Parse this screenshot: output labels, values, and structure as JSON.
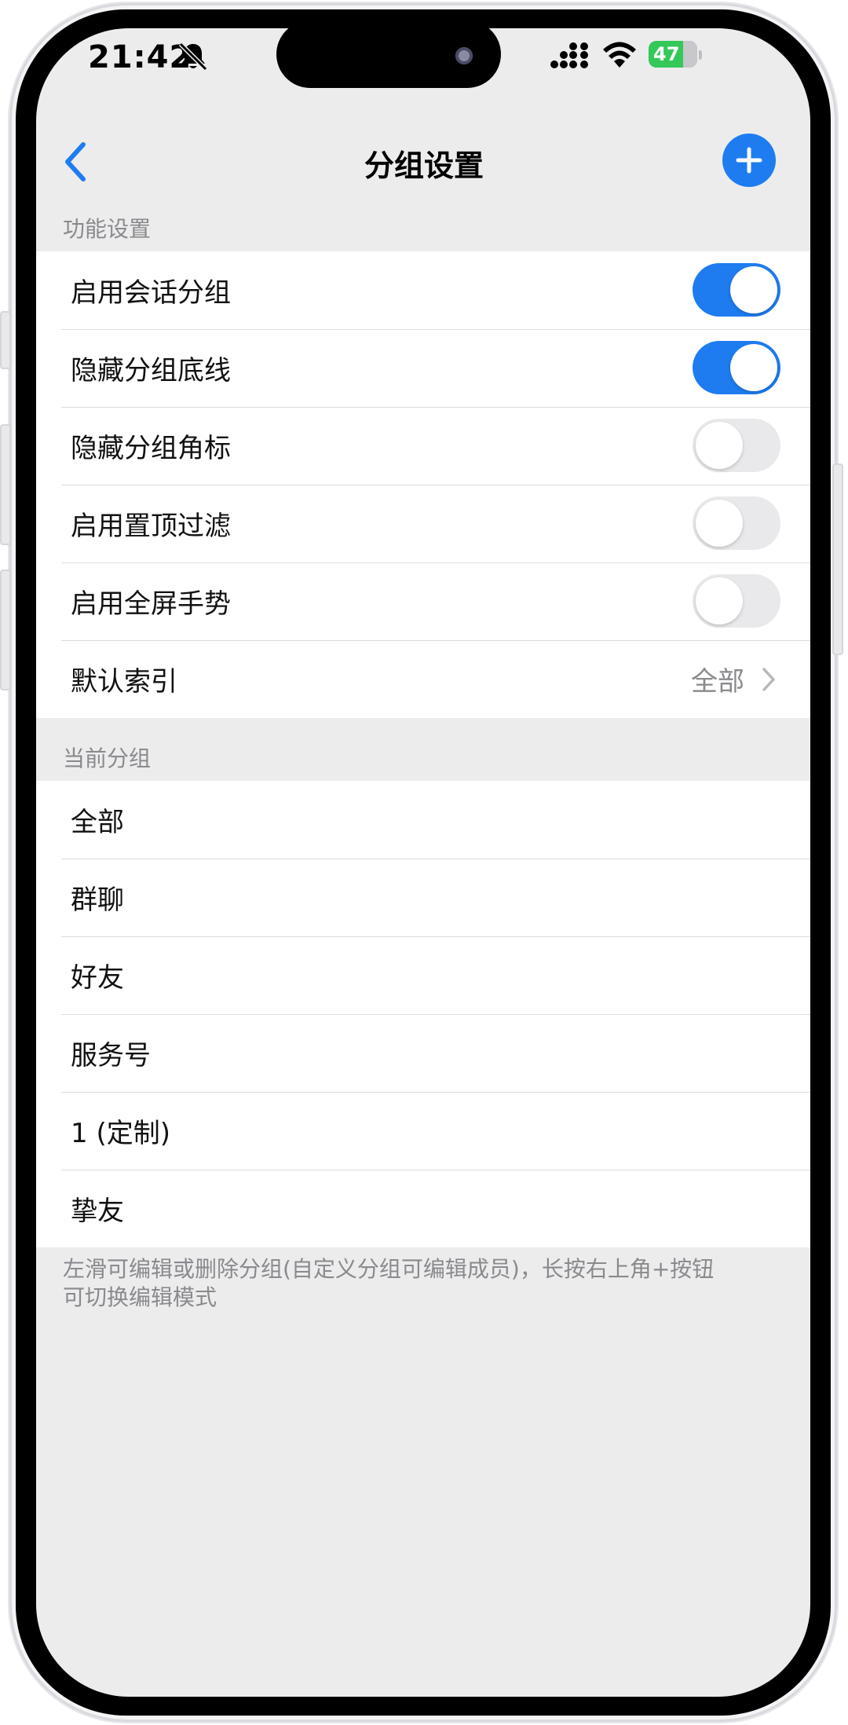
{
  "status_bar": {
    "time": "21:42",
    "battery": "47"
  },
  "nav": {
    "title": "分组设置"
  },
  "sections": {
    "function_header": "功能设置",
    "current_header": "当前分组"
  },
  "settings": [
    {
      "label": "启用会话分组",
      "on": true
    },
    {
      "label": "隐藏分组底线",
      "on": true
    },
    {
      "label": "隐藏分组角标",
      "on": false
    },
    {
      "label": "启用置顶过滤",
      "on": false
    },
    {
      "label": "启用全屏手势",
      "on": false
    }
  ],
  "default_index": {
    "label": "默认索引",
    "value": "全部"
  },
  "groups": [
    "全部",
    "群聊",
    "好友",
    "服务号",
    "1 (定制)",
    "挚友"
  ],
  "footer": {
    "line1": "左滑可编辑或删除分组(自定义分组可编辑成员)，长按右上角+按钮",
    "line2": "可切换编辑模式"
  },
  "colors": {
    "accent": "#1e7cf0",
    "background": "#ececed",
    "battery": "#34c759"
  }
}
